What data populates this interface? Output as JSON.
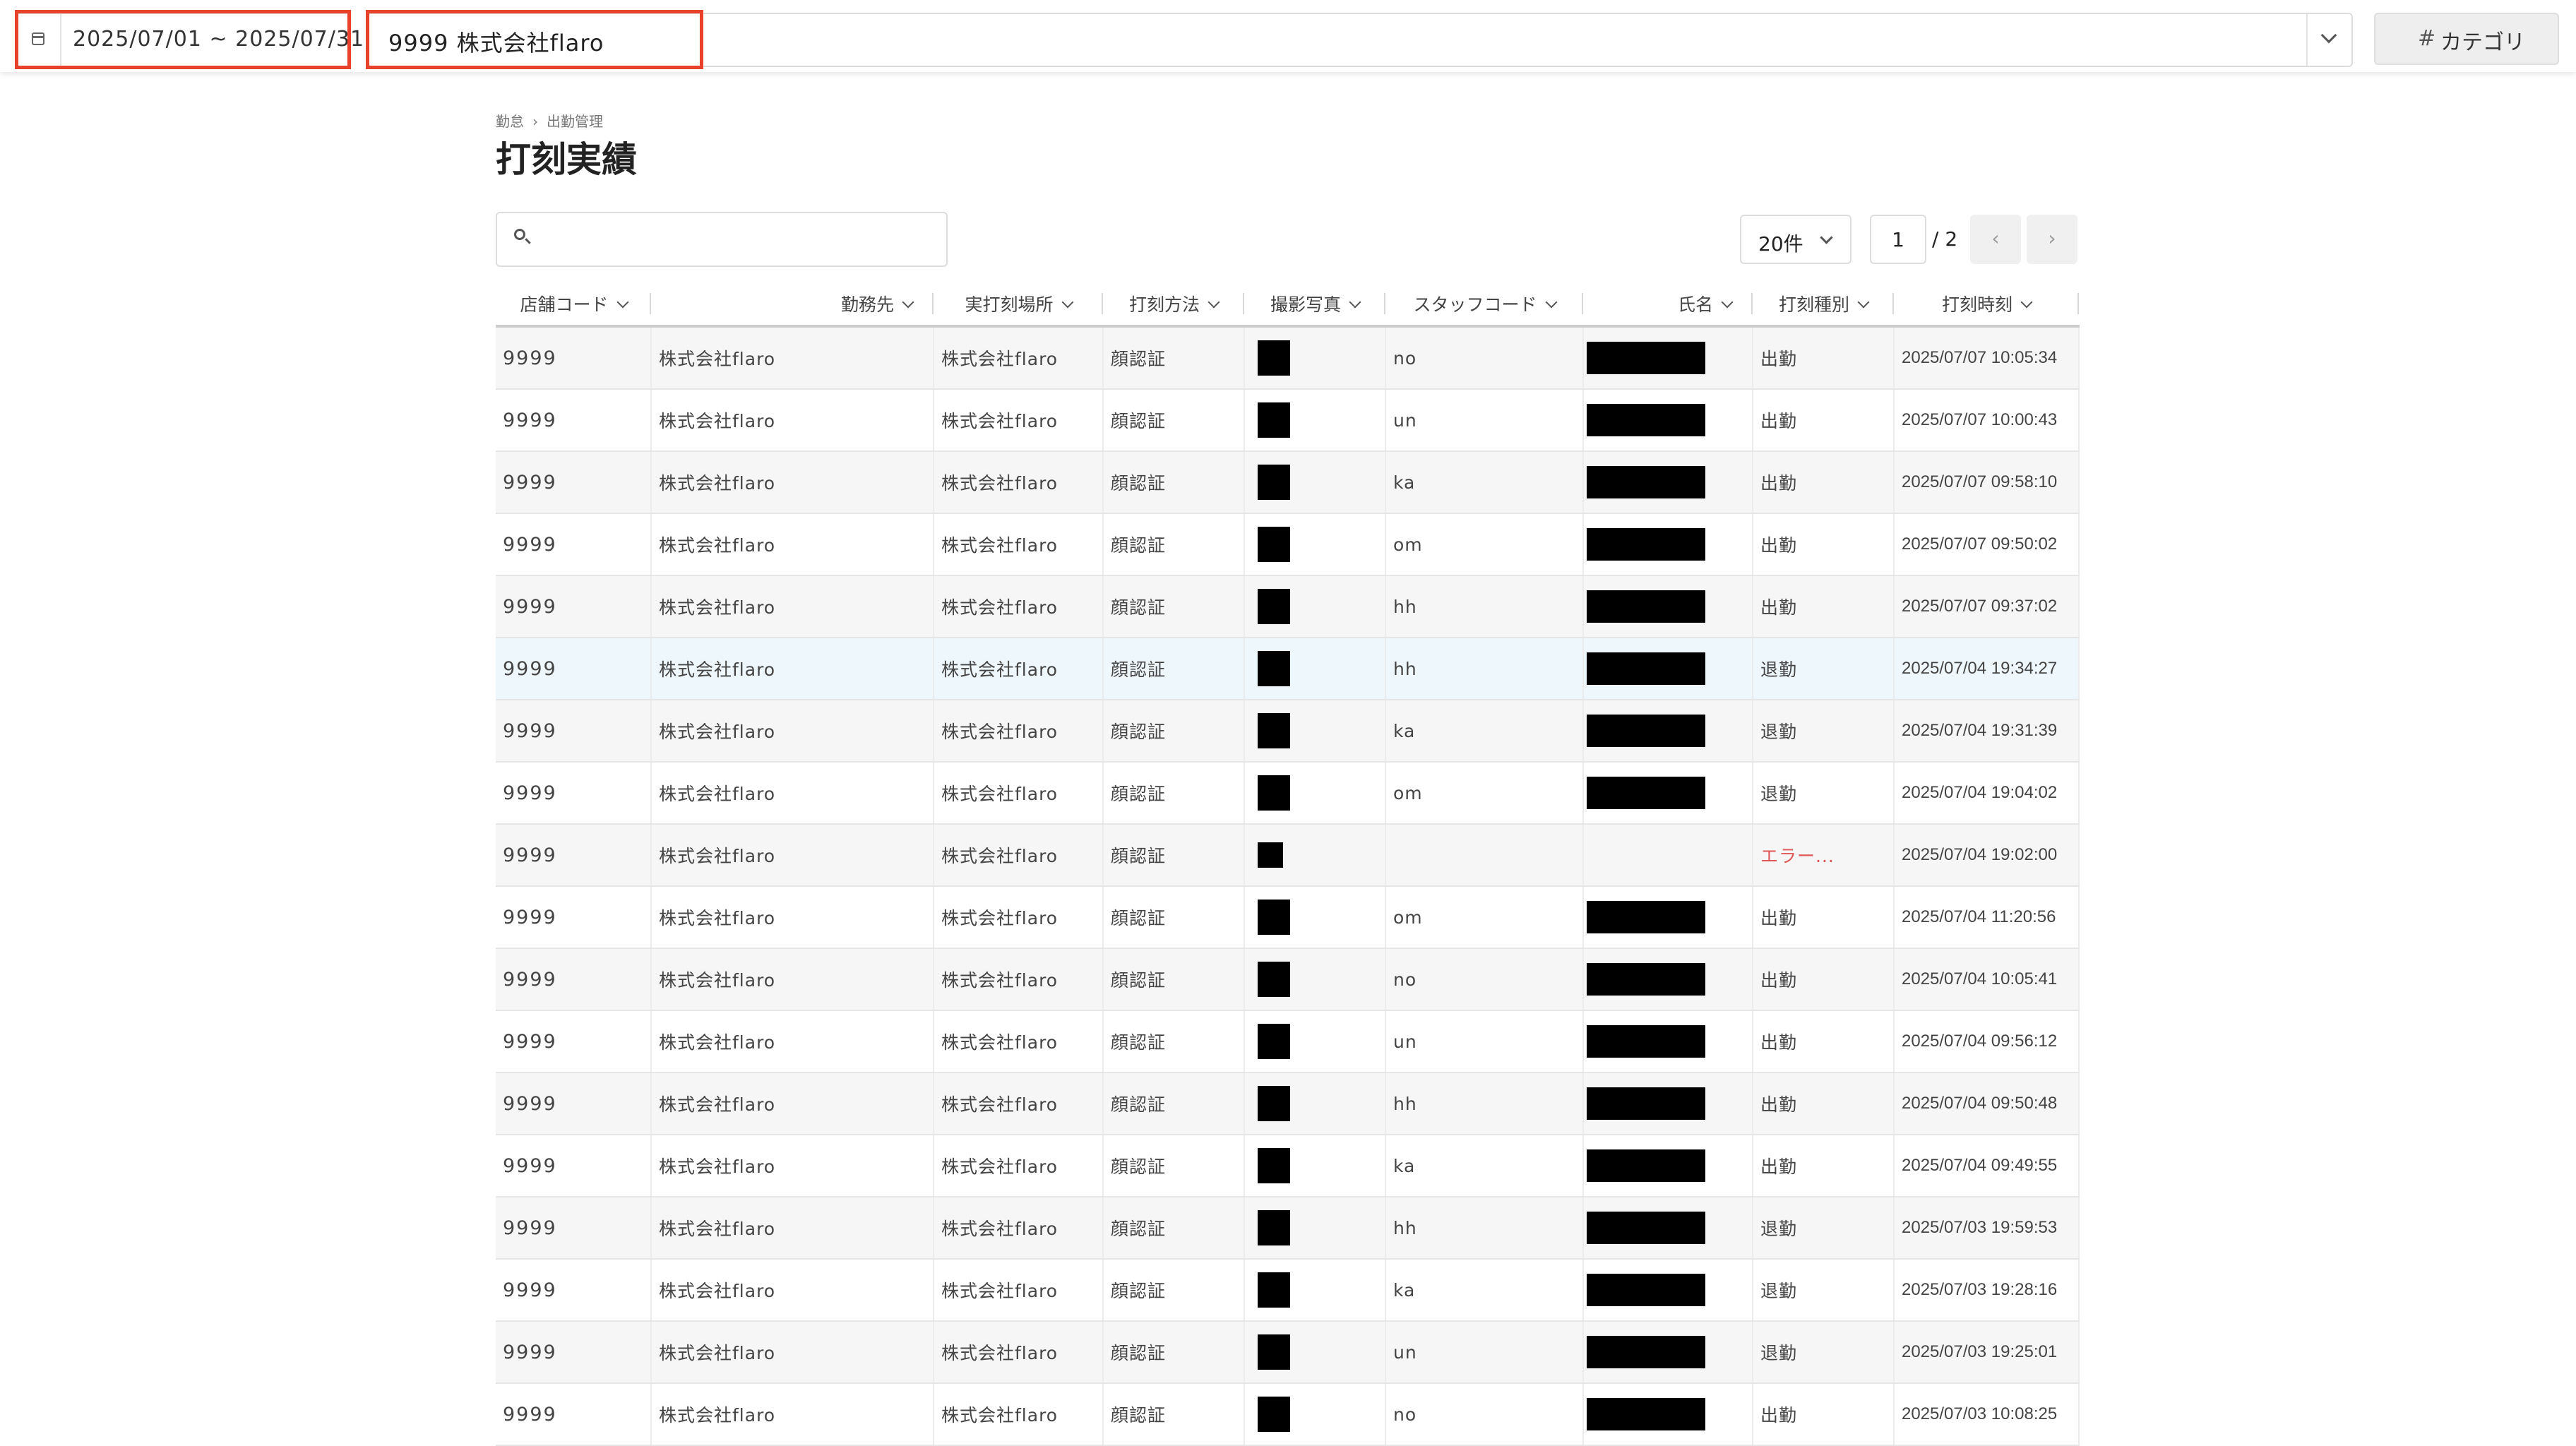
{
  "toolbar": {
    "date_range": "2025/07/01 ~ 2025/07/31",
    "organization": "9999 株式会社flaro",
    "category_label": "カテゴリ",
    "category_icon": "hash-icon",
    "highlight_color": "#e8412c"
  },
  "breadcrumb": {
    "items": [
      "勤怠",
      "出勤管理"
    ],
    "separator": "›"
  },
  "page_title": "打刻実績",
  "search": {
    "value": "",
    "placeholder": ""
  },
  "pagination": {
    "per_page": "20件",
    "current_page": "1",
    "total_label": "/ 2",
    "prev": "‹",
    "next": "›"
  },
  "table": {
    "columns": [
      "店舗コード",
      "勤務先",
      "実打刻場所",
      "打刻方法",
      "撮影写真",
      "スタッフコード",
      "氏名",
      "打刻種別",
      "打刻時刻"
    ],
    "rows": [
      {
        "store_code": "9999",
        "workplace": "株式会社flaro",
        "location": "株式会社flaro",
        "method": "顔認証",
        "staff_code": "no",
        "name_redacted": true,
        "type": "出勤",
        "time": "2025/07/07 10:05:34"
      },
      {
        "store_code": "9999",
        "workplace": "株式会社flaro",
        "location": "株式会社flaro",
        "method": "顔認証",
        "staff_code": "un",
        "name_redacted": true,
        "type": "出勤",
        "time": "2025/07/07 10:00:43"
      },
      {
        "store_code": "9999",
        "workplace": "株式会社flaro",
        "location": "株式会社flaro",
        "method": "顔認証",
        "staff_code": "ka",
        "name_redacted": true,
        "type": "出勤",
        "time": "2025/07/07 09:58:10"
      },
      {
        "store_code": "9999",
        "workplace": "株式会社flaro",
        "location": "株式会社flaro",
        "method": "顔認証",
        "staff_code": "om",
        "name_redacted": true,
        "type": "出勤",
        "time": "2025/07/07 09:50:02"
      },
      {
        "store_code": "9999",
        "workplace": "株式会社flaro",
        "location": "株式会社flaro",
        "method": "顔認証",
        "staff_code": "hh",
        "name_redacted": true,
        "type": "出勤",
        "time": "2025/07/07 09:37:02"
      },
      {
        "store_code": "9999",
        "workplace": "株式会社flaro",
        "location": "株式会社flaro",
        "method": "顔認証",
        "staff_code": "hh",
        "name_redacted": true,
        "type": "退勤",
        "time": "2025/07/04 19:34:27"
      },
      {
        "store_code": "9999",
        "workplace": "株式会社flaro",
        "location": "株式会社flaro",
        "method": "顔認証",
        "staff_code": "ka",
        "name_redacted": true,
        "type": "退勤",
        "time": "2025/07/04 19:31:39"
      },
      {
        "store_code": "9999",
        "workplace": "株式会社flaro",
        "location": "株式会社flaro",
        "method": "顔認証",
        "staff_code": "om",
        "name_redacted": true,
        "type": "退勤",
        "time": "2025/07/04 19:04:02"
      },
      {
        "store_code": "9999",
        "workplace": "株式会社flaro",
        "location": "株式会社flaro",
        "method": "顔認証",
        "staff_code": "",
        "name_redacted": false,
        "type": "エラー...",
        "time": "2025/07/04 19:02:00",
        "error": true
      },
      {
        "store_code": "9999",
        "workplace": "株式会社flaro",
        "location": "株式会社flaro",
        "method": "顔認証",
        "staff_code": "om",
        "name_redacted": true,
        "type": "出勤",
        "time": "2025/07/04 11:20:56"
      },
      {
        "store_code": "9999",
        "workplace": "株式会社flaro",
        "location": "株式会社flaro",
        "method": "顔認証",
        "staff_code": "no",
        "name_redacted": true,
        "type": "出勤",
        "time": "2025/07/04 10:05:41"
      },
      {
        "store_code": "9999",
        "workplace": "株式会社flaro",
        "location": "株式会社flaro",
        "method": "顔認証",
        "staff_code": "un",
        "name_redacted": true,
        "type": "出勤",
        "time": "2025/07/04 09:56:12"
      },
      {
        "store_code": "9999",
        "workplace": "株式会社flaro",
        "location": "株式会社flaro",
        "method": "顔認証",
        "staff_code": "hh",
        "name_redacted": true,
        "type": "出勤",
        "time": "2025/07/04 09:50:48"
      },
      {
        "store_code": "9999",
        "workplace": "株式会社flaro",
        "location": "株式会社flaro",
        "method": "顔認証",
        "staff_code": "ka",
        "name_redacted": true,
        "type": "出勤",
        "time": "2025/07/04 09:49:55"
      },
      {
        "store_code": "9999",
        "workplace": "株式会社flaro",
        "location": "株式会社flaro",
        "method": "顔認証",
        "staff_code": "hh",
        "name_redacted": true,
        "type": "退勤",
        "time": "2025/07/03 19:59:53"
      },
      {
        "store_code": "9999",
        "workplace": "株式会社flaro",
        "location": "株式会社flaro",
        "method": "顔認証",
        "staff_code": "ka",
        "name_redacted": true,
        "type": "退勤",
        "time": "2025/07/03 19:28:16"
      },
      {
        "store_code": "9999",
        "workplace": "株式会社flaro",
        "location": "株式会社flaro",
        "method": "顔認証",
        "staff_code": "un",
        "name_redacted": true,
        "type": "退勤",
        "time": "2025/07/03 19:25:01"
      },
      {
        "store_code": "9999",
        "workplace": "株式会社flaro",
        "location": "株式会社flaro",
        "method": "顔認証",
        "staff_code": "no",
        "name_redacted": true,
        "type": "出勤",
        "time": "2025/07/03 10:08:25"
      }
    ]
  }
}
